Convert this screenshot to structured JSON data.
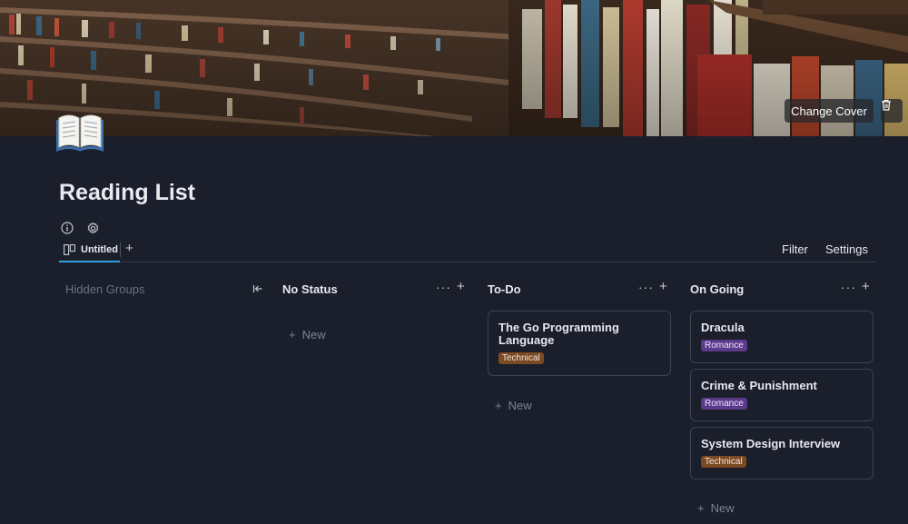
{
  "cover": {
    "change_cover_label": "Change Cover",
    "delete_icon": "trash-icon",
    "page_icon": "open-book-icon"
  },
  "page": {
    "title": "Reading List",
    "info_icon": "info-icon",
    "settings_icon": "gear-icon"
  },
  "view_bar": {
    "tab_label": "Untitled",
    "tab_icon": "board-icon",
    "add_view": "+",
    "filter_label": "Filter",
    "settings_label": "Settings",
    "accent": "#2f9fe0"
  },
  "board": {
    "hidden_groups_label": "Hidden Groups",
    "new_label": "New",
    "more_glyph": "···",
    "add_glyph": "+",
    "columns": [
      {
        "name": "No Status",
        "cards": []
      },
      {
        "name": "To-Do",
        "cards": [
          {
            "title": "The Go Programming Language",
            "tag": "Technical"
          }
        ]
      },
      {
        "name": "On Going",
        "cards": [
          {
            "title": "Dracula",
            "tag": "Romance"
          },
          {
            "title": "Crime & Punishment",
            "tag": "Romance"
          },
          {
            "title": "System Design Interview",
            "tag": "Technical"
          }
        ]
      }
    ]
  },
  "colors": {
    "background": "#1b1f2b",
    "tag_technical": "#7a4a22",
    "tag_romance": "#5b3a8c"
  }
}
